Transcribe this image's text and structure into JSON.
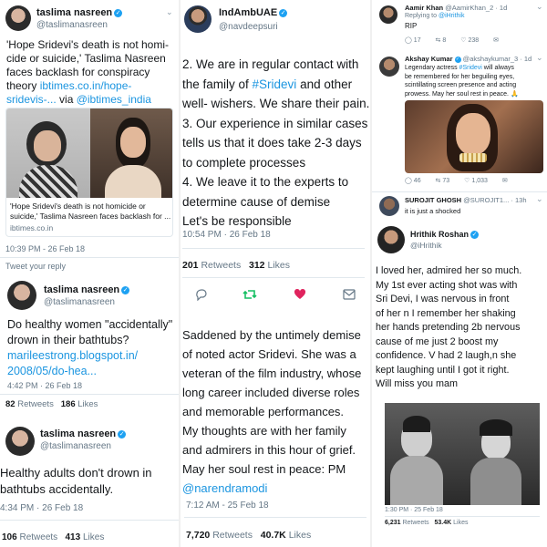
{
  "t1": {
    "name": "taslima nasreen",
    "handle": "@taslimanasreen",
    "text_lines": [
      "'Hope Sridevi's death is not homi-",
      "cide or suicide,' Taslima Nasreen",
      "faces backlash for conspiracy"
    ],
    "text_theory": "theory ",
    "link1": "ibtimes.co.in/hope-",
    "link2": "sridevis-...",
    "via": " via ",
    "mention": "@ibtimes_india",
    "card_title_1": "'Hope Sridevi's death is not homicide or",
    "card_title_2": "suicide,' Taslima Nasreen faces backlash for ...",
    "card_domain": "ibtimes.co.in",
    "timestamp": "10:39 PM - 26 Feb 18",
    "reply_label": "Tweet your reply"
  },
  "t2": {
    "name": "taslima nasreen",
    "handle": "@taslimanasreen",
    "text_1": "Do healthy women \"accidentally\"",
    "text_2": "drown in their bathtubs?",
    "link1": "marileestrong.blogspot.in/",
    "link2": "2008/05/do-hea...",
    "timestamp": "4:42 PM · 26 Feb 18",
    "retweets": "82",
    "retweets_label": "Retweets",
    "likes": "186",
    "likes_label": "Likes"
  },
  "t3": {
    "name": "taslima nasreen",
    "handle": "@taslimanasreen",
    "text_1": "Healthy adults don't drown in",
    "text_2": "bathtubs accidentally.",
    "timestamp": "4:34 PM · 26 Feb 18",
    "retweets": "106",
    "retweets_label": "Retweets",
    "likes": "413",
    "likes_label": "Likes"
  },
  "t4": {
    "name": "IndAmbUAE",
    "handle": "@navdeepsuri",
    "lines": [
      "2. We are in regular contact with",
      "the family of ",
      "#Sridevi",
      " and other",
      "well- wishers. We share their pain.",
      "3. Our experience in similar cases",
      "tells us that it does take 2-3 days",
      "to complete processes",
      "4. We leave it to the experts to",
      "determine cause of demise",
      "Let's be responsible"
    ],
    "timestamp": "10:54 PM · 26 Feb 18",
    "retweets": "201",
    "retweets_label": "Retweets",
    "likes": "312",
    "likes_label": "Likes"
  },
  "t5": {
    "lines": [
      "Saddened by the untimely demise",
      "of noted actor Sridevi. She was a",
      "veteran of the film industry, whose",
      "long career included diverse roles",
      "and memorable performances.",
      "My thoughts are with her family",
      "and admirers in this hour of grief.",
      "May her soul rest in peace: PM"
    ],
    "mention": "@narendramodi",
    "timestamp": "7:12 AM - 25 Feb 18",
    "retweets": "7,720",
    "retweets_label": "Retweets",
    "likes": "40.7K",
    "likes_label": "Likes"
  },
  "t6": {
    "name": "Aamir Khan",
    "handle": "@AamirKhan_2 · 1d",
    "replying_prefix": "Replying to ",
    "replying_to": "@iHrithik",
    "text": "RIP",
    "replies": "17",
    "retweets": "8",
    "likes": "238"
  },
  "t7": {
    "name": "Akshay Kumar",
    "handle": "@akshaykumar_3 · 1d",
    "text_1": "Legendary actress ",
    "hashtag": "#Sridevi",
    "text_2": " will always",
    "text_3": "be remembered for her beguiling eyes,",
    "text_4": "scintillating screen presence and acting",
    "text_5": "prowess. May her soul rest in peace. 🙏",
    "replies": "46",
    "retweets": "73",
    "likes": "1,033"
  },
  "t8": {
    "name": "SUROJIT GHOSH",
    "handle": "@SUROJIT1... · 13h",
    "text": "it is just a shocked"
  },
  "t9": {
    "name": "Hrithik Roshan",
    "handle": "@iHrithik",
    "lines": [
      "I loved her, admired her so much.",
      "My 1st ever acting shot was with",
      "Sri Devi, I was nervous in front",
      "of her n I remember her shaking",
      "her hands pretending 2b nervous",
      "cause of me just 2 boost my",
      "confidence. V had 2 laugh,n she",
      "kept laughing until I got it right.",
      "Will miss you mam"
    ],
    "timestamp": "1:30 PM · 25 Feb 18",
    "retweets": "6,231",
    "retweets_label": "Retweets",
    "likes": "53.4K",
    "likes_label": "Likes"
  }
}
